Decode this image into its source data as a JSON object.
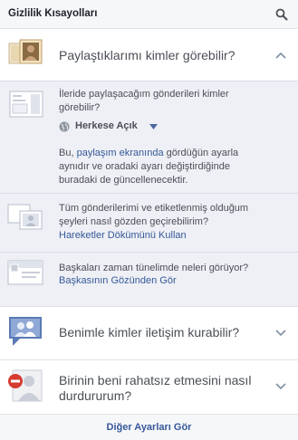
{
  "header": {
    "title": "Gizlilik Kısayolları",
    "search_icon": "search-icon"
  },
  "sections": [
    {
      "title": "Paylaştıklarımı kimler görebilir?",
      "icon": "photo-frame-person-icon",
      "expanded": true,
      "items": [
        {
          "icon": "future-posts-icon",
          "text": "İleride paylaşacağım gönderileri kimler görebilir?",
          "audience": {
            "label": "Herkese Açık",
            "icon": "globe-icon"
          },
          "note_prefix": "Bu, ",
          "note_link": "paylaşım ekranında",
          "note_suffix": " gördüğün ayarla aynıdır ve oradaki ayarı değiştirdiğinde buradaki de güncellenecektir."
        },
        {
          "icon": "activity-log-icon",
          "text": "Tüm gönderilerimi ve etiketlenmiş olduğum şeyleri nasıl gözden geçirebilirim?",
          "link": "Hareketler Dökümünü Kullan"
        },
        {
          "icon": "timeline-view-icon",
          "text": "Başkaları zaman tünelimde neleri görüyor?",
          "link": "Başkasının Gözünden Gör"
        }
      ]
    },
    {
      "title": "Benimle kimler iletişim kurabilir?",
      "icon": "people-speech-icon",
      "expanded": false
    },
    {
      "title": "Birinin beni rahatsız etmesini nasıl durdururum?",
      "title_line1": "Birinin beni rahatsız etmesini nasıl",
      "title_line2": "durdururum?",
      "icon": "block-person-icon",
      "expanded": false
    }
  ],
  "footer": {
    "label": "Diğer Ayarları Gör"
  },
  "colors": {
    "link": "#365899",
    "expanded_bg": "#eef0f5",
    "header_bg": "#f6f7f9"
  }
}
